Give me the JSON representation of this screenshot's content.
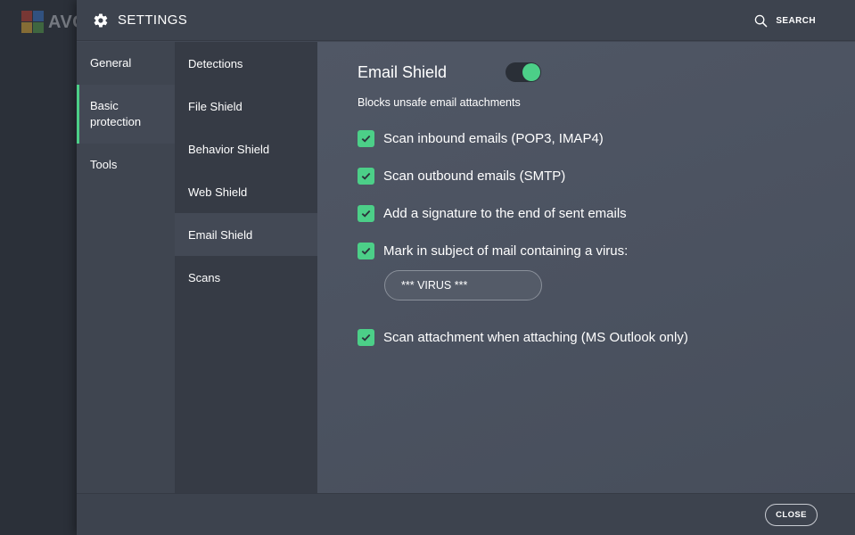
{
  "background_app": {
    "logo_text": "AVG",
    "logo_colors": [
      "#d6402f",
      "#3a7bd5",
      "#f2b632",
      "#58a84a"
    ]
  },
  "header": {
    "title": "SETTINGS",
    "title_icon": "gear-icon",
    "search_label": "SEARCH",
    "search_icon": "search-icon"
  },
  "categories": [
    {
      "label": "General",
      "active": false
    },
    {
      "label": "Basic protection",
      "active": true
    },
    {
      "label": "Tools",
      "active": false
    }
  ],
  "subcategories": [
    {
      "label": "Detections",
      "active": false
    },
    {
      "label": "File Shield",
      "active": false
    },
    {
      "label": "Behavior Shield",
      "active": false
    },
    {
      "label": "Web Shield",
      "active": false
    },
    {
      "label": "Email Shield",
      "active": true
    },
    {
      "label": "Scans",
      "active": false
    }
  ],
  "content": {
    "title": "Email Shield",
    "enabled": true,
    "description": "Blocks unsafe email attachments",
    "options": [
      {
        "label": "Scan inbound emails (POP3, IMAP4)",
        "checked": true
      },
      {
        "label": "Scan outbound emails (SMTP)",
        "checked": true
      },
      {
        "label": "Add a signature to the end of sent emails",
        "checked": true
      },
      {
        "label": "Mark in subject of mail containing a virus:",
        "checked": true
      },
      {
        "label": "Scan attachment when attaching (MS Outlook only)",
        "checked": true
      }
    ],
    "virus_subject_value": "*** VIRUS ***"
  },
  "footer": {
    "close_label": "CLOSE"
  },
  "colors": {
    "accent": "#4ccf88",
    "header_bg": "#3d434e",
    "content_bg": "#4d5462"
  }
}
